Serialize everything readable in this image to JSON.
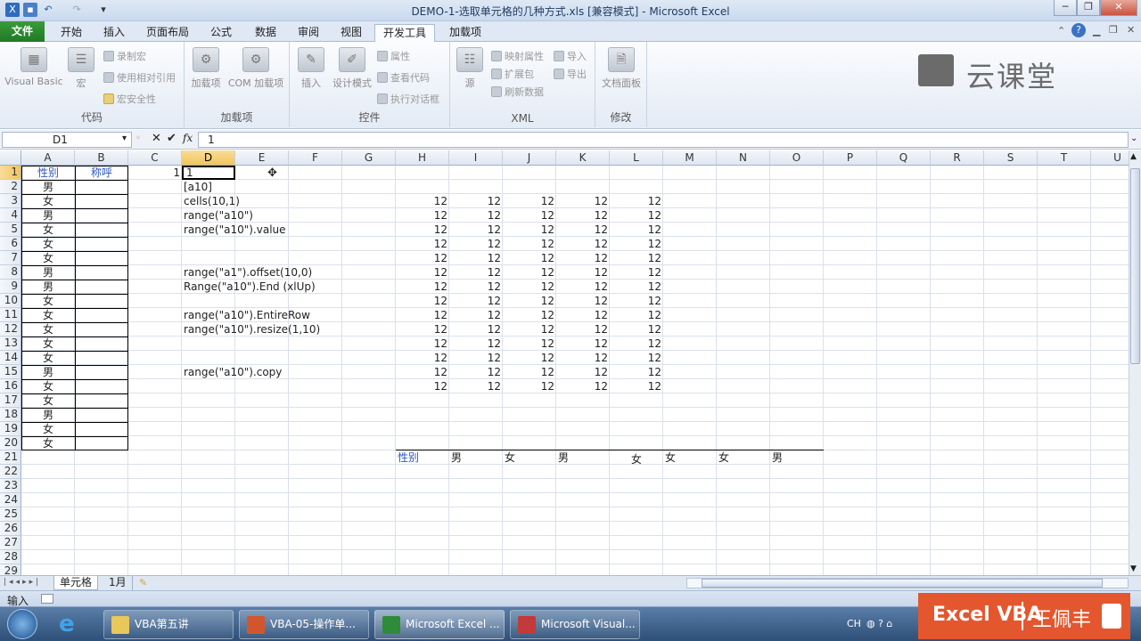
{
  "window": {
    "title": "DEMO-1-选取单元格的几种方式.xls  [兼容模式]  -  Microsoft Excel",
    "min": "─",
    "max": "❐",
    "close": "✕"
  },
  "tabs": [
    "文件",
    "开始",
    "插入",
    "页面布局",
    "公式",
    "数据",
    "审阅",
    "视图",
    "开发工具",
    "加载项"
  ],
  "active_tab": "开发工具",
  "ribbon": {
    "code": {
      "label": "代码",
      "vb": "Visual Basic",
      "macros": "宏",
      "record": "录制宏",
      "relative": "使用相对引用",
      "security": "宏安全性"
    },
    "addins": {
      "label": "加载项",
      "addins": "加载项",
      "com": "COM 加载项"
    },
    "controls": {
      "label": "控件",
      "insert": "插入",
      "design": "设计模式",
      "props": "属性",
      "view_code": "查看代码",
      "dialog": "执行对话框"
    },
    "xml": {
      "label": "XML",
      "source": "源",
      "map_props": "映射属性",
      "expansion": "扩展包",
      "refresh": "刷新数据",
      "import": "导入",
      "export": "导出"
    },
    "modify": {
      "label": "修改",
      "doc_panel": "文档面板"
    },
    "watermark": "云课堂"
  },
  "formula_bar": {
    "name_box": "D1",
    "fx": "fx",
    "value": "1"
  },
  "columns": [
    "A",
    "B",
    "C",
    "D",
    "E",
    "F",
    "G",
    "H",
    "I",
    "J",
    "K",
    "L",
    "M",
    "N",
    "O",
    "P",
    "Q",
    "R",
    "S",
    "T",
    "U"
  ],
  "rows": [
    "1",
    "2",
    "3",
    "4",
    "5",
    "6",
    "7",
    "8",
    "9",
    "10",
    "11",
    "12",
    "13",
    "14",
    "15",
    "16",
    "17",
    "18",
    "19",
    "20",
    "21",
    "22",
    "23",
    "24",
    "25",
    "26",
    "27",
    "28",
    "29"
  ],
  "selected": {
    "column": "D",
    "row": "1"
  },
  "sheet": {
    "header_gender": "性别",
    "header_title": "称呼",
    "genders": [
      "男",
      "女",
      "男",
      "女",
      "女",
      "女",
      "男",
      "男",
      "女",
      "女",
      "女",
      "女",
      "女",
      "男",
      "女",
      "女",
      "男",
      "女",
      "女"
    ],
    "c1": "1",
    "d1": "1",
    "d_col": {
      "r2": "[a10]",
      "r3": "cells(10,1)",
      "r4": "range(\"a10\")",
      "r5": "range(\"a10\").value",
      "r8": "range(\"a1\").offset(10,0)",
      "r9": "Range(\"a10\").End (xlUp)",
      "r11": "range(\"a10\").EntireRow",
      "r12": "range(\"a10\").resize(1,10)",
      "r15": "range(\"a10\").copy"
    },
    "num_value": "12",
    "row21": {
      "label": "性别",
      "values": [
        "男",
        "女",
        "男",
        "女",
        "女",
        "女",
        "男"
      ]
    }
  },
  "sheet_tabs": [
    "单元格",
    "1月"
  ],
  "status": "输入",
  "taskbar": {
    "items": [
      "VBA第五讲",
      "VBA-05-操作单...",
      "Microsoft Excel ...",
      "Microsoft Visual..."
    ],
    "lang": "CH",
    "brand": "Excel VBA",
    "author": "王佩丰"
  }
}
